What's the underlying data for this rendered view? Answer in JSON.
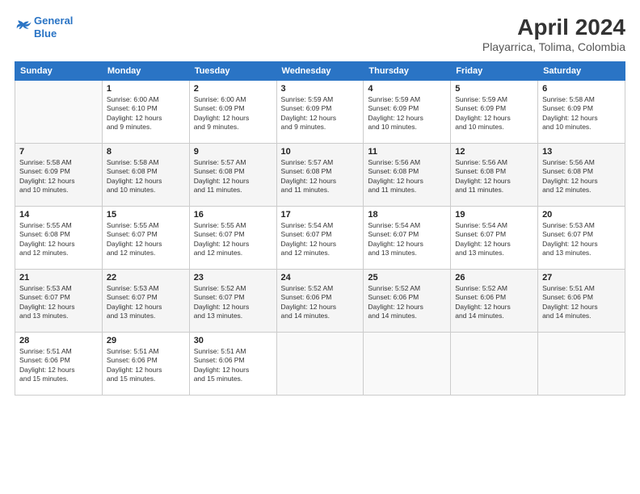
{
  "header": {
    "logo_line1": "General",
    "logo_line2": "Blue",
    "title": "April 2024",
    "subtitle": "Playarrica, Tolima, Colombia"
  },
  "columns": [
    "Sunday",
    "Monday",
    "Tuesday",
    "Wednesday",
    "Thursday",
    "Friday",
    "Saturday"
  ],
  "weeks": [
    [
      {
        "day": "",
        "info": ""
      },
      {
        "day": "1",
        "info": "Sunrise: 6:00 AM\nSunset: 6:10 PM\nDaylight: 12 hours\nand 9 minutes."
      },
      {
        "day": "2",
        "info": "Sunrise: 6:00 AM\nSunset: 6:09 PM\nDaylight: 12 hours\nand 9 minutes."
      },
      {
        "day": "3",
        "info": "Sunrise: 5:59 AM\nSunset: 6:09 PM\nDaylight: 12 hours\nand 9 minutes."
      },
      {
        "day": "4",
        "info": "Sunrise: 5:59 AM\nSunset: 6:09 PM\nDaylight: 12 hours\nand 10 minutes."
      },
      {
        "day": "5",
        "info": "Sunrise: 5:59 AM\nSunset: 6:09 PM\nDaylight: 12 hours\nand 10 minutes."
      },
      {
        "day": "6",
        "info": "Sunrise: 5:58 AM\nSunset: 6:09 PM\nDaylight: 12 hours\nand 10 minutes."
      }
    ],
    [
      {
        "day": "7",
        "info": "Sunrise: 5:58 AM\nSunset: 6:09 PM\nDaylight: 12 hours\nand 10 minutes."
      },
      {
        "day": "8",
        "info": "Sunrise: 5:58 AM\nSunset: 6:08 PM\nDaylight: 12 hours\nand 10 minutes."
      },
      {
        "day": "9",
        "info": "Sunrise: 5:57 AM\nSunset: 6:08 PM\nDaylight: 12 hours\nand 11 minutes."
      },
      {
        "day": "10",
        "info": "Sunrise: 5:57 AM\nSunset: 6:08 PM\nDaylight: 12 hours\nand 11 minutes."
      },
      {
        "day": "11",
        "info": "Sunrise: 5:56 AM\nSunset: 6:08 PM\nDaylight: 12 hours\nand 11 minutes."
      },
      {
        "day": "12",
        "info": "Sunrise: 5:56 AM\nSunset: 6:08 PM\nDaylight: 12 hours\nand 11 minutes."
      },
      {
        "day": "13",
        "info": "Sunrise: 5:56 AM\nSunset: 6:08 PM\nDaylight: 12 hours\nand 12 minutes."
      }
    ],
    [
      {
        "day": "14",
        "info": "Sunrise: 5:55 AM\nSunset: 6:08 PM\nDaylight: 12 hours\nand 12 minutes."
      },
      {
        "day": "15",
        "info": "Sunrise: 5:55 AM\nSunset: 6:07 PM\nDaylight: 12 hours\nand 12 minutes."
      },
      {
        "day": "16",
        "info": "Sunrise: 5:55 AM\nSunset: 6:07 PM\nDaylight: 12 hours\nand 12 minutes."
      },
      {
        "day": "17",
        "info": "Sunrise: 5:54 AM\nSunset: 6:07 PM\nDaylight: 12 hours\nand 12 minutes."
      },
      {
        "day": "18",
        "info": "Sunrise: 5:54 AM\nSunset: 6:07 PM\nDaylight: 12 hours\nand 13 minutes."
      },
      {
        "day": "19",
        "info": "Sunrise: 5:54 AM\nSunset: 6:07 PM\nDaylight: 12 hours\nand 13 minutes."
      },
      {
        "day": "20",
        "info": "Sunrise: 5:53 AM\nSunset: 6:07 PM\nDaylight: 12 hours\nand 13 minutes."
      }
    ],
    [
      {
        "day": "21",
        "info": "Sunrise: 5:53 AM\nSunset: 6:07 PM\nDaylight: 12 hours\nand 13 minutes."
      },
      {
        "day": "22",
        "info": "Sunrise: 5:53 AM\nSunset: 6:07 PM\nDaylight: 12 hours\nand 13 minutes."
      },
      {
        "day": "23",
        "info": "Sunrise: 5:52 AM\nSunset: 6:07 PM\nDaylight: 12 hours\nand 13 minutes."
      },
      {
        "day": "24",
        "info": "Sunrise: 5:52 AM\nSunset: 6:06 PM\nDaylight: 12 hours\nand 14 minutes."
      },
      {
        "day": "25",
        "info": "Sunrise: 5:52 AM\nSunset: 6:06 PM\nDaylight: 12 hours\nand 14 minutes."
      },
      {
        "day": "26",
        "info": "Sunrise: 5:52 AM\nSunset: 6:06 PM\nDaylight: 12 hours\nand 14 minutes."
      },
      {
        "day": "27",
        "info": "Sunrise: 5:51 AM\nSunset: 6:06 PM\nDaylight: 12 hours\nand 14 minutes."
      }
    ],
    [
      {
        "day": "28",
        "info": "Sunrise: 5:51 AM\nSunset: 6:06 PM\nDaylight: 12 hours\nand 15 minutes."
      },
      {
        "day": "29",
        "info": "Sunrise: 5:51 AM\nSunset: 6:06 PM\nDaylight: 12 hours\nand 15 minutes."
      },
      {
        "day": "30",
        "info": "Sunrise: 5:51 AM\nSunset: 6:06 PM\nDaylight: 12 hours\nand 15 minutes."
      },
      {
        "day": "",
        "info": ""
      },
      {
        "day": "",
        "info": ""
      },
      {
        "day": "",
        "info": ""
      },
      {
        "day": "",
        "info": ""
      }
    ]
  ]
}
